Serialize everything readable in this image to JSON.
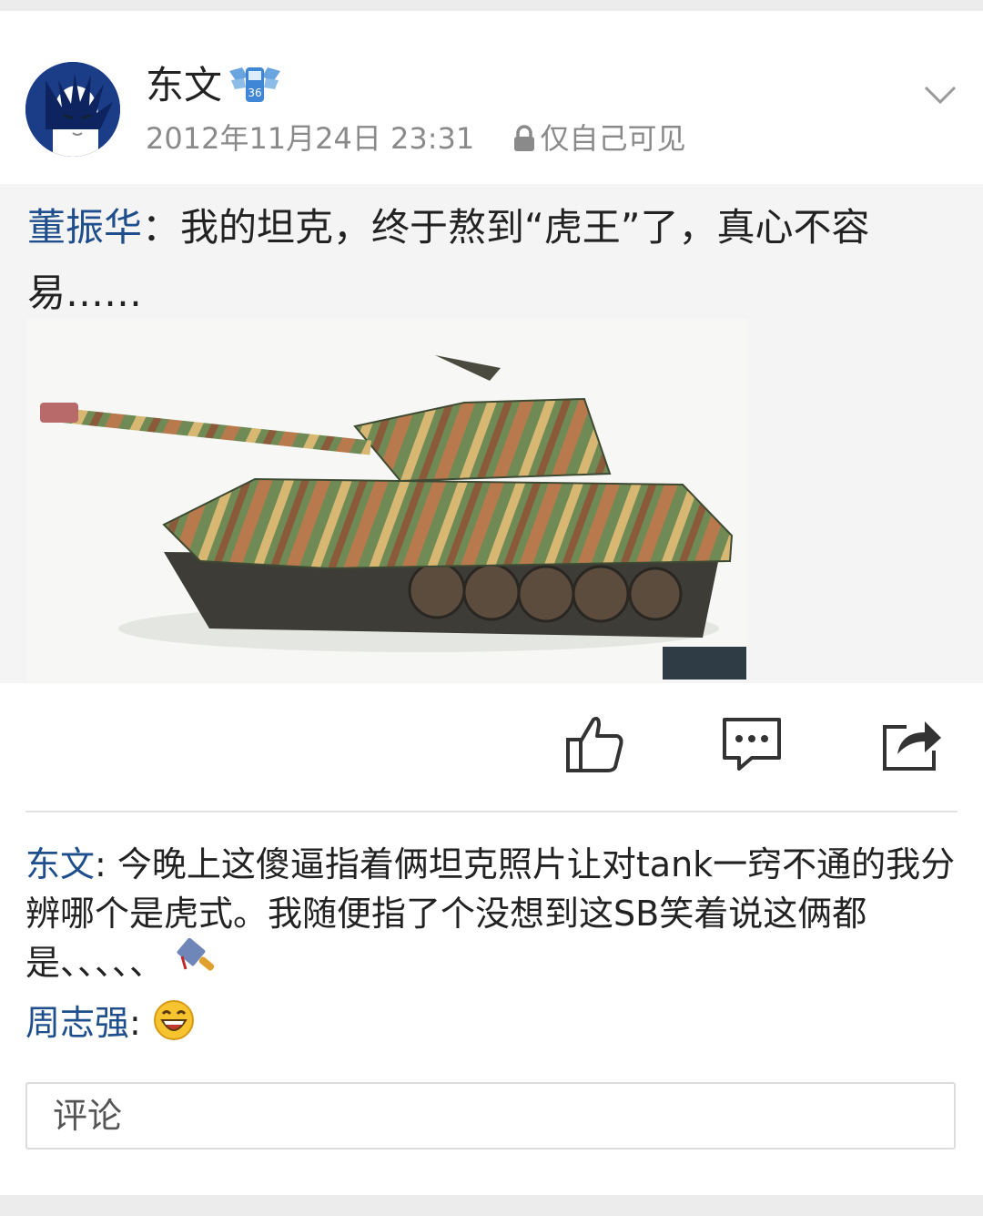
{
  "post": {
    "author": "东文",
    "author_badge_icon": "vip-badge-icon",
    "timestamp": "2012年11月24日 23:31",
    "visibility": "仅自己可见",
    "menu_icon": "chevron-down-icon"
  },
  "repost": {
    "source_user": "董振华",
    "separator": "：",
    "text": "我的坦克，终于熬到“虎王”了，真心不容易……",
    "image_icon": "tank-photo"
  },
  "actions": [
    {
      "name": "like",
      "icon": "thumbs-up-icon"
    },
    {
      "name": "comment",
      "icon": "comment-icon"
    },
    {
      "name": "share",
      "icon": "share-icon"
    }
  ],
  "comments": [
    {
      "user": "东文",
      "sep": ": ",
      "text": "今晚上这傻逼指着俩坦克照片让对tank一窍不通的我分辨哪个是虎式。我随便指了个没想到这SB笑着说这俩都是、、、、、",
      "trail_icon": "cleaver-icon"
    },
    {
      "user": "周志强",
      "sep": ": ",
      "text": "",
      "trail_icon": "laughing-emoji-icon"
    }
  ],
  "comment_input": {
    "placeholder": "评论"
  },
  "colors": {
    "link": "#1f4e8c",
    "meta": "#8a8a8a",
    "background": "#ececec"
  }
}
